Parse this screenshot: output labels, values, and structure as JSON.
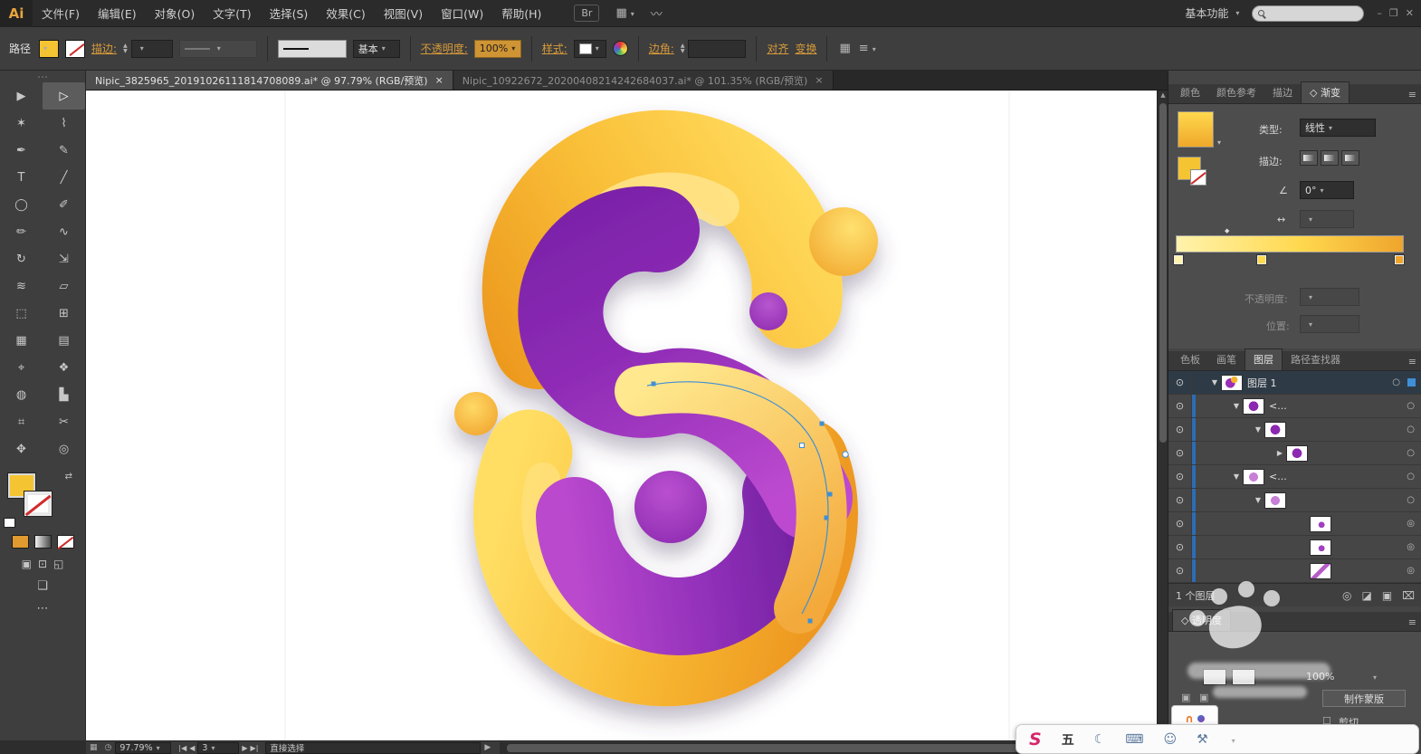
{
  "colors": {
    "accent_amber": "#d79a3a",
    "selection_blue": "#3f8fd6",
    "artwork_yellow": "#F9BE37",
    "artwork_orange": "#EE9A23",
    "artwork_purple": "#8F2CB6",
    "artwork_magenta": "#BB49CE"
  },
  "icons": {
    "dropdown": "▾",
    "eye": "⊙",
    "menu": "≡",
    "diamond": "◇",
    "locate": "◎",
    "clip_mask": "◪",
    "new_layer": "▣",
    "delete_layer": "⌧",
    "swap": "⇄",
    "moon": "☾",
    "keyboard": "⌨",
    "person": "☺",
    "wrench": "⚒",
    "grid": "▦",
    "clock": "◷",
    "first": "|◀",
    "prev": "◀",
    "next": "▶",
    "last": "▶|",
    "play": "▶",
    "min": "–",
    "restore": "❐",
    "win_close": "✕",
    "signature": "〰",
    "angle": "∠",
    "aspect": "↔",
    "midpoint": "◆",
    "checkbox": "☐",
    "scroll_up": "▲",
    "scroll_down": "▼",
    "draw_normal": "▣",
    "draw_behind": "⊡",
    "draw_inside": "◱",
    "screen_mode": "❏",
    "more": "⋯",
    "layout": "▦"
  },
  "menubar": {
    "logo": "Ai",
    "items": [
      "文件(F)",
      "编辑(E)",
      "对象(O)",
      "文字(T)",
      "选择(S)",
      "效果(C)",
      "视图(V)",
      "窗口(W)",
      "帮助(H)"
    ],
    "bridge_label": "Br",
    "workspace_label": "基本功能",
    "search_value": ""
  },
  "controlbar": {
    "selection_type": "路径",
    "stroke_label": "描边:",
    "brush_value": "基本",
    "opacity_label": "不透明度:",
    "opacity_value": "100%",
    "style_label": "样式:",
    "corner_label": "边角:",
    "align_label": "对齐",
    "transform_label": "变换"
  },
  "document_tabs": [
    {
      "title": "Nipic_3825965_20191026111814708089.ai* @ 97.79% (RGB/预览)",
      "close_label": "×"
    },
    {
      "title": "Nipic_10922672_20200408214242684037.ai* @ 101.35% (RGB/预览)",
      "close_label": "×"
    }
  ],
  "toolbar": {
    "tools": [
      {
        "name": "selection-tool",
        "glyph": "▶"
      },
      {
        "name": "direct-selection-tool",
        "glyph": "▷"
      },
      {
        "name": "magic-wand-tool",
        "glyph": "✶"
      },
      {
        "name": "lasso-tool",
        "glyph": "⌇"
      },
      {
        "name": "pen-tool",
        "glyph": "✒"
      },
      {
        "name": "curvature-tool",
        "glyph": "✎"
      },
      {
        "name": "type-tool",
        "glyph": "T"
      },
      {
        "name": "line-segment-tool",
        "glyph": "╱"
      },
      {
        "name": "ellipse-tool",
        "glyph": "◯"
      },
      {
        "name": "paintbrush-tool",
        "glyph": "✐"
      },
      {
        "name": "pencil-tool",
        "glyph": "✏"
      },
      {
        "name": "shaper-tool",
        "glyph": "∿"
      },
      {
        "name": "rotate-tool",
        "glyph": "↻"
      },
      {
        "name": "scale-tool",
        "glyph": "⇲"
      },
      {
        "name": "width-tool",
        "glyph": "≋"
      },
      {
        "name": "free-transform-tool",
        "glyph": "▱"
      },
      {
        "name": "shape-builder-tool",
        "glyph": "⬚"
      },
      {
        "name": "perspective-grid-tool",
        "glyph": "⊞"
      },
      {
        "name": "mesh-tool",
        "glyph": "▦"
      },
      {
        "name": "gradient-tool",
        "glyph": "▤"
      },
      {
        "name": "eyedropper-tool",
        "glyph": "⌖"
      },
      {
        "name": "blend-tool",
        "glyph": "❖"
      },
      {
        "name": "symbol-sprayer-tool",
        "glyph": "◍"
      },
      {
        "name": "graph-tool",
        "glyph": "▙"
      },
      {
        "name": "artboard-tool",
        "glyph": "⌗"
      },
      {
        "name": "slice-tool",
        "glyph": "✂"
      },
      {
        "name": "hand-tool",
        "glyph": "✥"
      },
      {
        "name": "zoom-tool",
        "glyph": "◎"
      }
    ]
  },
  "gradient_panel": {
    "tab_color": "颜色",
    "tab_color_guide": "颜色参考",
    "tab_stroke": "描边",
    "tab_gradient": "渐变",
    "type_label": "类型:",
    "type_value": "线性",
    "stroke_label": "描边:",
    "angle_value": "0°",
    "opacity_label": "不透明度:",
    "location_label": "位置:"
  },
  "layers_panel": {
    "tab_swatches": "色板",
    "tab_brushes": "画笔",
    "tab_layers": "图层",
    "tab_pathfinder": "路径查找器",
    "rows": [
      {
        "label": "图层 1",
        "arrow": "▼",
        "target": "○"
      },
      {
        "label": "<...",
        "arrow": "▼",
        "target": "○"
      },
      {
        "label": "",
        "arrow": "▼",
        "target": "○"
      },
      {
        "label": "",
        "arrow": "▶",
        "target": "○"
      },
      {
        "label": "<...",
        "arrow": "▼",
        "target": "○"
      },
      {
        "label": "",
        "arrow": "▼",
        "target": "○"
      },
      {
        "label": "",
        "arrow": "",
        "target": "◎"
      },
      {
        "label": "",
        "arrow": "",
        "target": "◎"
      },
      {
        "label": "",
        "arrow": "",
        "target": "◎"
      }
    ],
    "footer_count": "1 个图层"
  },
  "transparency_panel": {
    "tab_label": "透明度",
    "opacity_value": "100%",
    "make_mask_label": "制作蒙版",
    "clip_label": "剪切"
  },
  "statusbar": {
    "zoom_value": "97.79%",
    "nav_value": "3",
    "tool_name": "直接选择"
  },
  "ime_bar": {
    "engine_letter": "S",
    "mode_label": "五"
  }
}
